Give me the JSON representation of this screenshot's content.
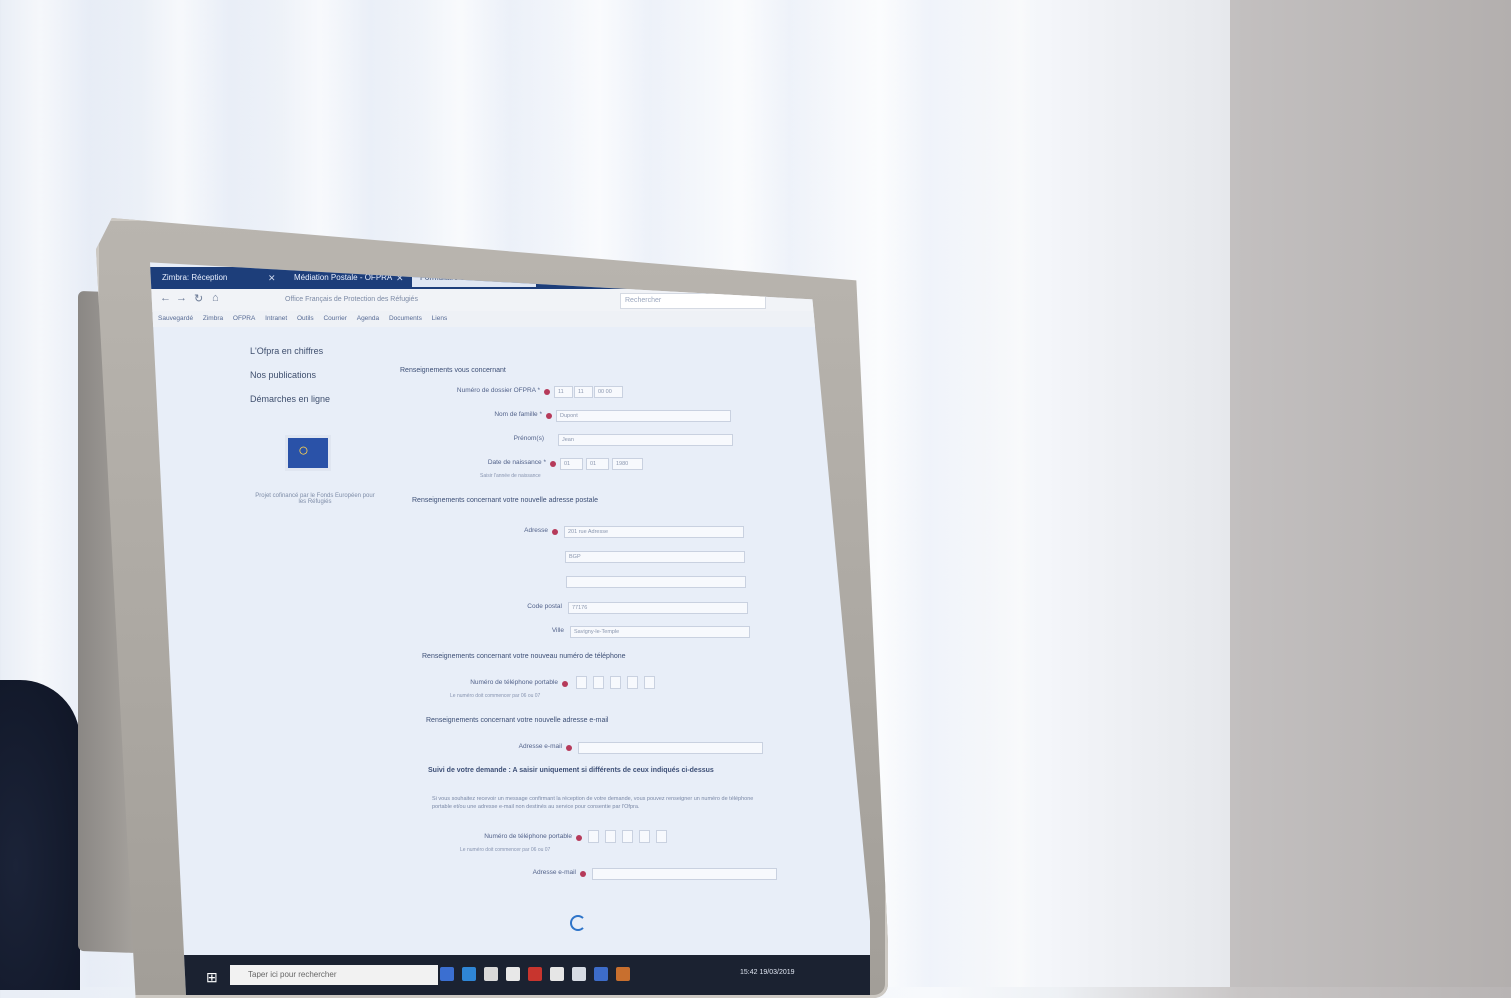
{
  "browser": {
    "tabs": [
      {
        "label": "Zimbra: Réception",
        "active": false
      },
      {
        "label": "Médiation Postale - OFPRA",
        "active": false
      },
      {
        "label": "Formulaire demande - OFPRA",
        "active": true
      }
    ],
    "new_tab": "+",
    "url": "Office Français de Protection des Réfugiés",
    "search_placeholder": "Rechercher",
    "bookmarks": [
      "Sauvegardé",
      "Zimbra",
      "OFPRA",
      "Intranet",
      "Outils",
      "Courrier",
      "Agenda",
      "Documents",
      "Liens"
    ]
  },
  "sidebar": {
    "items": [
      "L'Ofpra en chiffres",
      "Nos publications",
      "Démarches en ligne"
    ],
    "eu_caption": "Projet cofinancé par le Fonds Européen pour les Réfugiés"
  },
  "form": {
    "sections": {
      "personal": "Renseignements vous concernant",
      "address": "Renseignements concernant votre nouvelle adresse postale",
      "phone": "Renseignements concernant votre nouveau numéro de téléphone",
      "email": "Renseignements concernant votre nouvelle adresse e-mail",
      "followup": "Suivi de votre demande : A saisir uniquement si différents de ceux indiqués ci-dessus"
    },
    "labels": {
      "dossier": "Numéro de dossier OFPRA *",
      "nom": "Nom de famille *",
      "prenoms": "Prénom(s)",
      "naissance": "Date de naissance *",
      "adresse": "Adresse",
      "code_postal": "Code postal",
      "ville": "Ville",
      "tel": "Numéro de téléphone portable",
      "email": "Adresse e-mail",
      "tel2": "Numéro de téléphone portable",
      "email2": "Adresse e-mail"
    },
    "values": {
      "dossier": [
        "11",
        "11",
        "00 00"
      ],
      "nom": "Dupont",
      "prenoms": "Jean",
      "naissance": [
        "01",
        "01",
        "1980"
      ],
      "adresse1": "201 rue Adresse",
      "adresse2": "BGP",
      "adresse3": "",
      "code_postal": "77176",
      "ville": "Savigny-le-Temple"
    },
    "hints": {
      "naissance": "Saisir l'année de naissance",
      "tel": "Le numéro doit commencer par 06 ou 07",
      "tel2": "Le numéro doit commencer par 06 ou 07"
    },
    "followup_note": "Si vous souhaitez recevoir un message confirmant la réception de votre demande, vous pouvez renseigner un numéro de téléphone portable et/ou une adresse e-mail non destinés au service pour consentie par l'Ofpra."
  },
  "taskbar": {
    "search_placeholder": "Taper ici pour rechercher",
    "clock": "15:42",
    "date": "19/03/2019"
  },
  "colors": {
    "tabbar": "#1d3e7a",
    "accent_dot": "#b63a5a",
    "taskbar": "#1b2231"
  }
}
